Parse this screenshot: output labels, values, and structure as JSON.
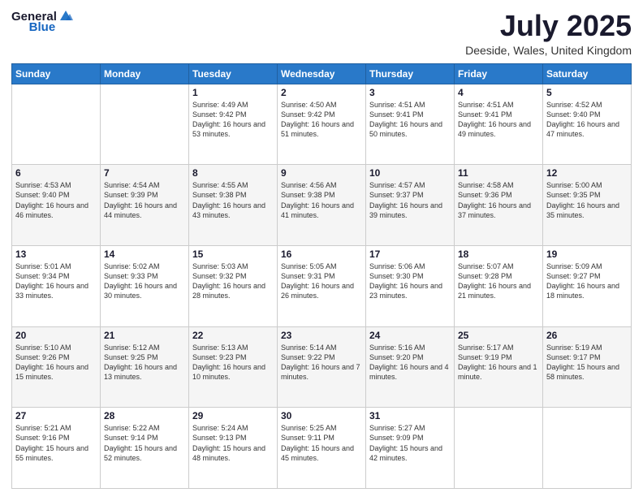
{
  "header": {
    "logo": {
      "general": "General",
      "blue": "Blue"
    },
    "title": "July 2025",
    "location": "Deeside, Wales, United Kingdom"
  },
  "calendar": {
    "days": [
      "Sunday",
      "Monday",
      "Tuesday",
      "Wednesday",
      "Thursday",
      "Friday",
      "Saturday"
    ],
    "weeks": [
      [
        {
          "day": "",
          "text": ""
        },
        {
          "day": "",
          "text": ""
        },
        {
          "day": "1",
          "text": "Sunrise: 4:49 AM\nSunset: 9:42 PM\nDaylight: 16 hours and 53 minutes."
        },
        {
          "day": "2",
          "text": "Sunrise: 4:50 AM\nSunset: 9:42 PM\nDaylight: 16 hours and 51 minutes."
        },
        {
          "day": "3",
          "text": "Sunrise: 4:51 AM\nSunset: 9:41 PM\nDaylight: 16 hours and 50 minutes."
        },
        {
          "day": "4",
          "text": "Sunrise: 4:51 AM\nSunset: 9:41 PM\nDaylight: 16 hours and 49 minutes."
        },
        {
          "day": "5",
          "text": "Sunrise: 4:52 AM\nSunset: 9:40 PM\nDaylight: 16 hours and 47 minutes."
        }
      ],
      [
        {
          "day": "6",
          "text": "Sunrise: 4:53 AM\nSunset: 9:40 PM\nDaylight: 16 hours and 46 minutes."
        },
        {
          "day": "7",
          "text": "Sunrise: 4:54 AM\nSunset: 9:39 PM\nDaylight: 16 hours and 44 minutes."
        },
        {
          "day": "8",
          "text": "Sunrise: 4:55 AM\nSunset: 9:38 PM\nDaylight: 16 hours and 43 minutes."
        },
        {
          "day": "9",
          "text": "Sunrise: 4:56 AM\nSunset: 9:38 PM\nDaylight: 16 hours and 41 minutes."
        },
        {
          "day": "10",
          "text": "Sunrise: 4:57 AM\nSunset: 9:37 PM\nDaylight: 16 hours and 39 minutes."
        },
        {
          "day": "11",
          "text": "Sunrise: 4:58 AM\nSunset: 9:36 PM\nDaylight: 16 hours and 37 minutes."
        },
        {
          "day": "12",
          "text": "Sunrise: 5:00 AM\nSunset: 9:35 PM\nDaylight: 16 hours and 35 minutes."
        }
      ],
      [
        {
          "day": "13",
          "text": "Sunrise: 5:01 AM\nSunset: 9:34 PM\nDaylight: 16 hours and 33 minutes."
        },
        {
          "day": "14",
          "text": "Sunrise: 5:02 AM\nSunset: 9:33 PM\nDaylight: 16 hours and 30 minutes."
        },
        {
          "day": "15",
          "text": "Sunrise: 5:03 AM\nSunset: 9:32 PM\nDaylight: 16 hours and 28 minutes."
        },
        {
          "day": "16",
          "text": "Sunrise: 5:05 AM\nSunset: 9:31 PM\nDaylight: 16 hours and 26 minutes."
        },
        {
          "day": "17",
          "text": "Sunrise: 5:06 AM\nSunset: 9:30 PM\nDaylight: 16 hours and 23 minutes."
        },
        {
          "day": "18",
          "text": "Sunrise: 5:07 AM\nSunset: 9:28 PM\nDaylight: 16 hours and 21 minutes."
        },
        {
          "day": "19",
          "text": "Sunrise: 5:09 AM\nSunset: 9:27 PM\nDaylight: 16 hours and 18 minutes."
        }
      ],
      [
        {
          "day": "20",
          "text": "Sunrise: 5:10 AM\nSunset: 9:26 PM\nDaylight: 16 hours and 15 minutes."
        },
        {
          "day": "21",
          "text": "Sunrise: 5:12 AM\nSunset: 9:25 PM\nDaylight: 16 hours and 13 minutes."
        },
        {
          "day": "22",
          "text": "Sunrise: 5:13 AM\nSunset: 9:23 PM\nDaylight: 16 hours and 10 minutes."
        },
        {
          "day": "23",
          "text": "Sunrise: 5:14 AM\nSunset: 9:22 PM\nDaylight: 16 hours and 7 minutes."
        },
        {
          "day": "24",
          "text": "Sunrise: 5:16 AM\nSunset: 9:20 PM\nDaylight: 16 hours and 4 minutes."
        },
        {
          "day": "25",
          "text": "Sunrise: 5:17 AM\nSunset: 9:19 PM\nDaylight: 16 hours and 1 minute."
        },
        {
          "day": "26",
          "text": "Sunrise: 5:19 AM\nSunset: 9:17 PM\nDaylight: 15 hours and 58 minutes."
        }
      ],
      [
        {
          "day": "27",
          "text": "Sunrise: 5:21 AM\nSunset: 9:16 PM\nDaylight: 15 hours and 55 minutes."
        },
        {
          "day": "28",
          "text": "Sunrise: 5:22 AM\nSunset: 9:14 PM\nDaylight: 15 hours and 52 minutes."
        },
        {
          "day": "29",
          "text": "Sunrise: 5:24 AM\nSunset: 9:13 PM\nDaylight: 15 hours and 48 minutes."
        },
        {
          "day": "30",
          "text": "Sunrise: 5:25 AM\nSunset: 9:11 PM\nDaylight: 15 hours and 45 minutes."
        },
        {
          "day": "31",
          "text": "Sunrise: 5:27 AM\nSunset: 9:09 PM\nDaylight: 15 hours and 42 minutes."
        },
        {
          "day": "",
          "text": ""
        },
        {
          "day": "",
          "text": ""
        }
      ]
    ]
  }
}
